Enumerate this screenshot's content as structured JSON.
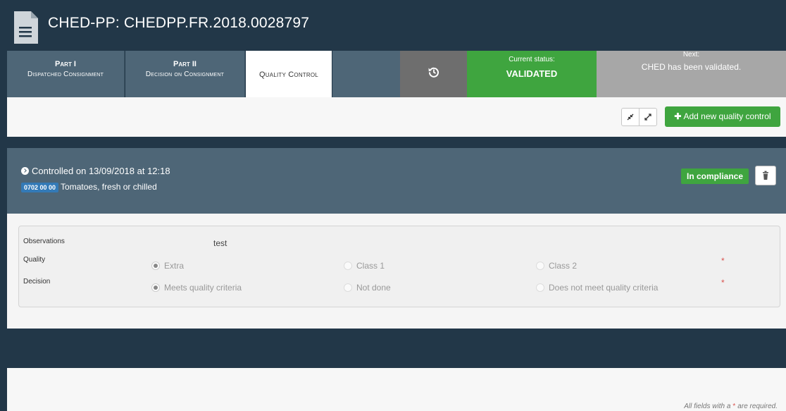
{
  "header": {
    "title": "CHED-PP: CHEDPP.FR.2018.0028797",
    "icon": "document-icon"
  },
  "tabs": {
    "part1": {
      "title": "Part I",
      "subtitle": "Dispatched Consignment"
    },
    "part2": {
      "title": "Part II",
      "subtitle": "Decision on Consignment"
    },
    "quality_control": {
      "label": "Quality Control"
    },
    "history_icon": "history-icon",
    "status": {
      "label": "Current status:",
      "value": "VALIDATED"
    },
    "next": {
      "label": "Next:",
      "value": "CHED has been validated."
    }
  },
  "toolbar": {
    "collapse_icon": "collapse-icon",
    "expand_icon": "expand-icon",
    "add_label": "Add new quality control"
  },
  "control": {
    "title": "Controlled on 13/09/2018 at 12:18",
    "cn_code": "0702 00 00",
    "commodity": "Tomatoes, fresh or chilled",
    "compliance": "In compliance",
    "observations_label": "Observations",
    "observations_value": "test",
    "quality_label": "Quality",
    "quality_options": [
      "Extra",
      "Class 1",
      "Class 2"
    ],
    "quality_selected": "Extra",
    "decision_label": "Decision",
    "decision_options": [
      "Meets quality criteria",
      "Not done",
      "Does not meet quality criteria"
    ],
    "decision_selected": "Meets quality criteria"
  },
  "footer": {
    "note_before": "All fields with a",
    "star": "*",
    "note_after": "are required."
  },
  "colors": {
    "header_bg": "#223748",
    "tab_bg": "#4e6677",
    "status_green": "#3fa53f",
    "next_gray": "#a7a7a7",
    "required_red": "#d9534f"
  }
}
